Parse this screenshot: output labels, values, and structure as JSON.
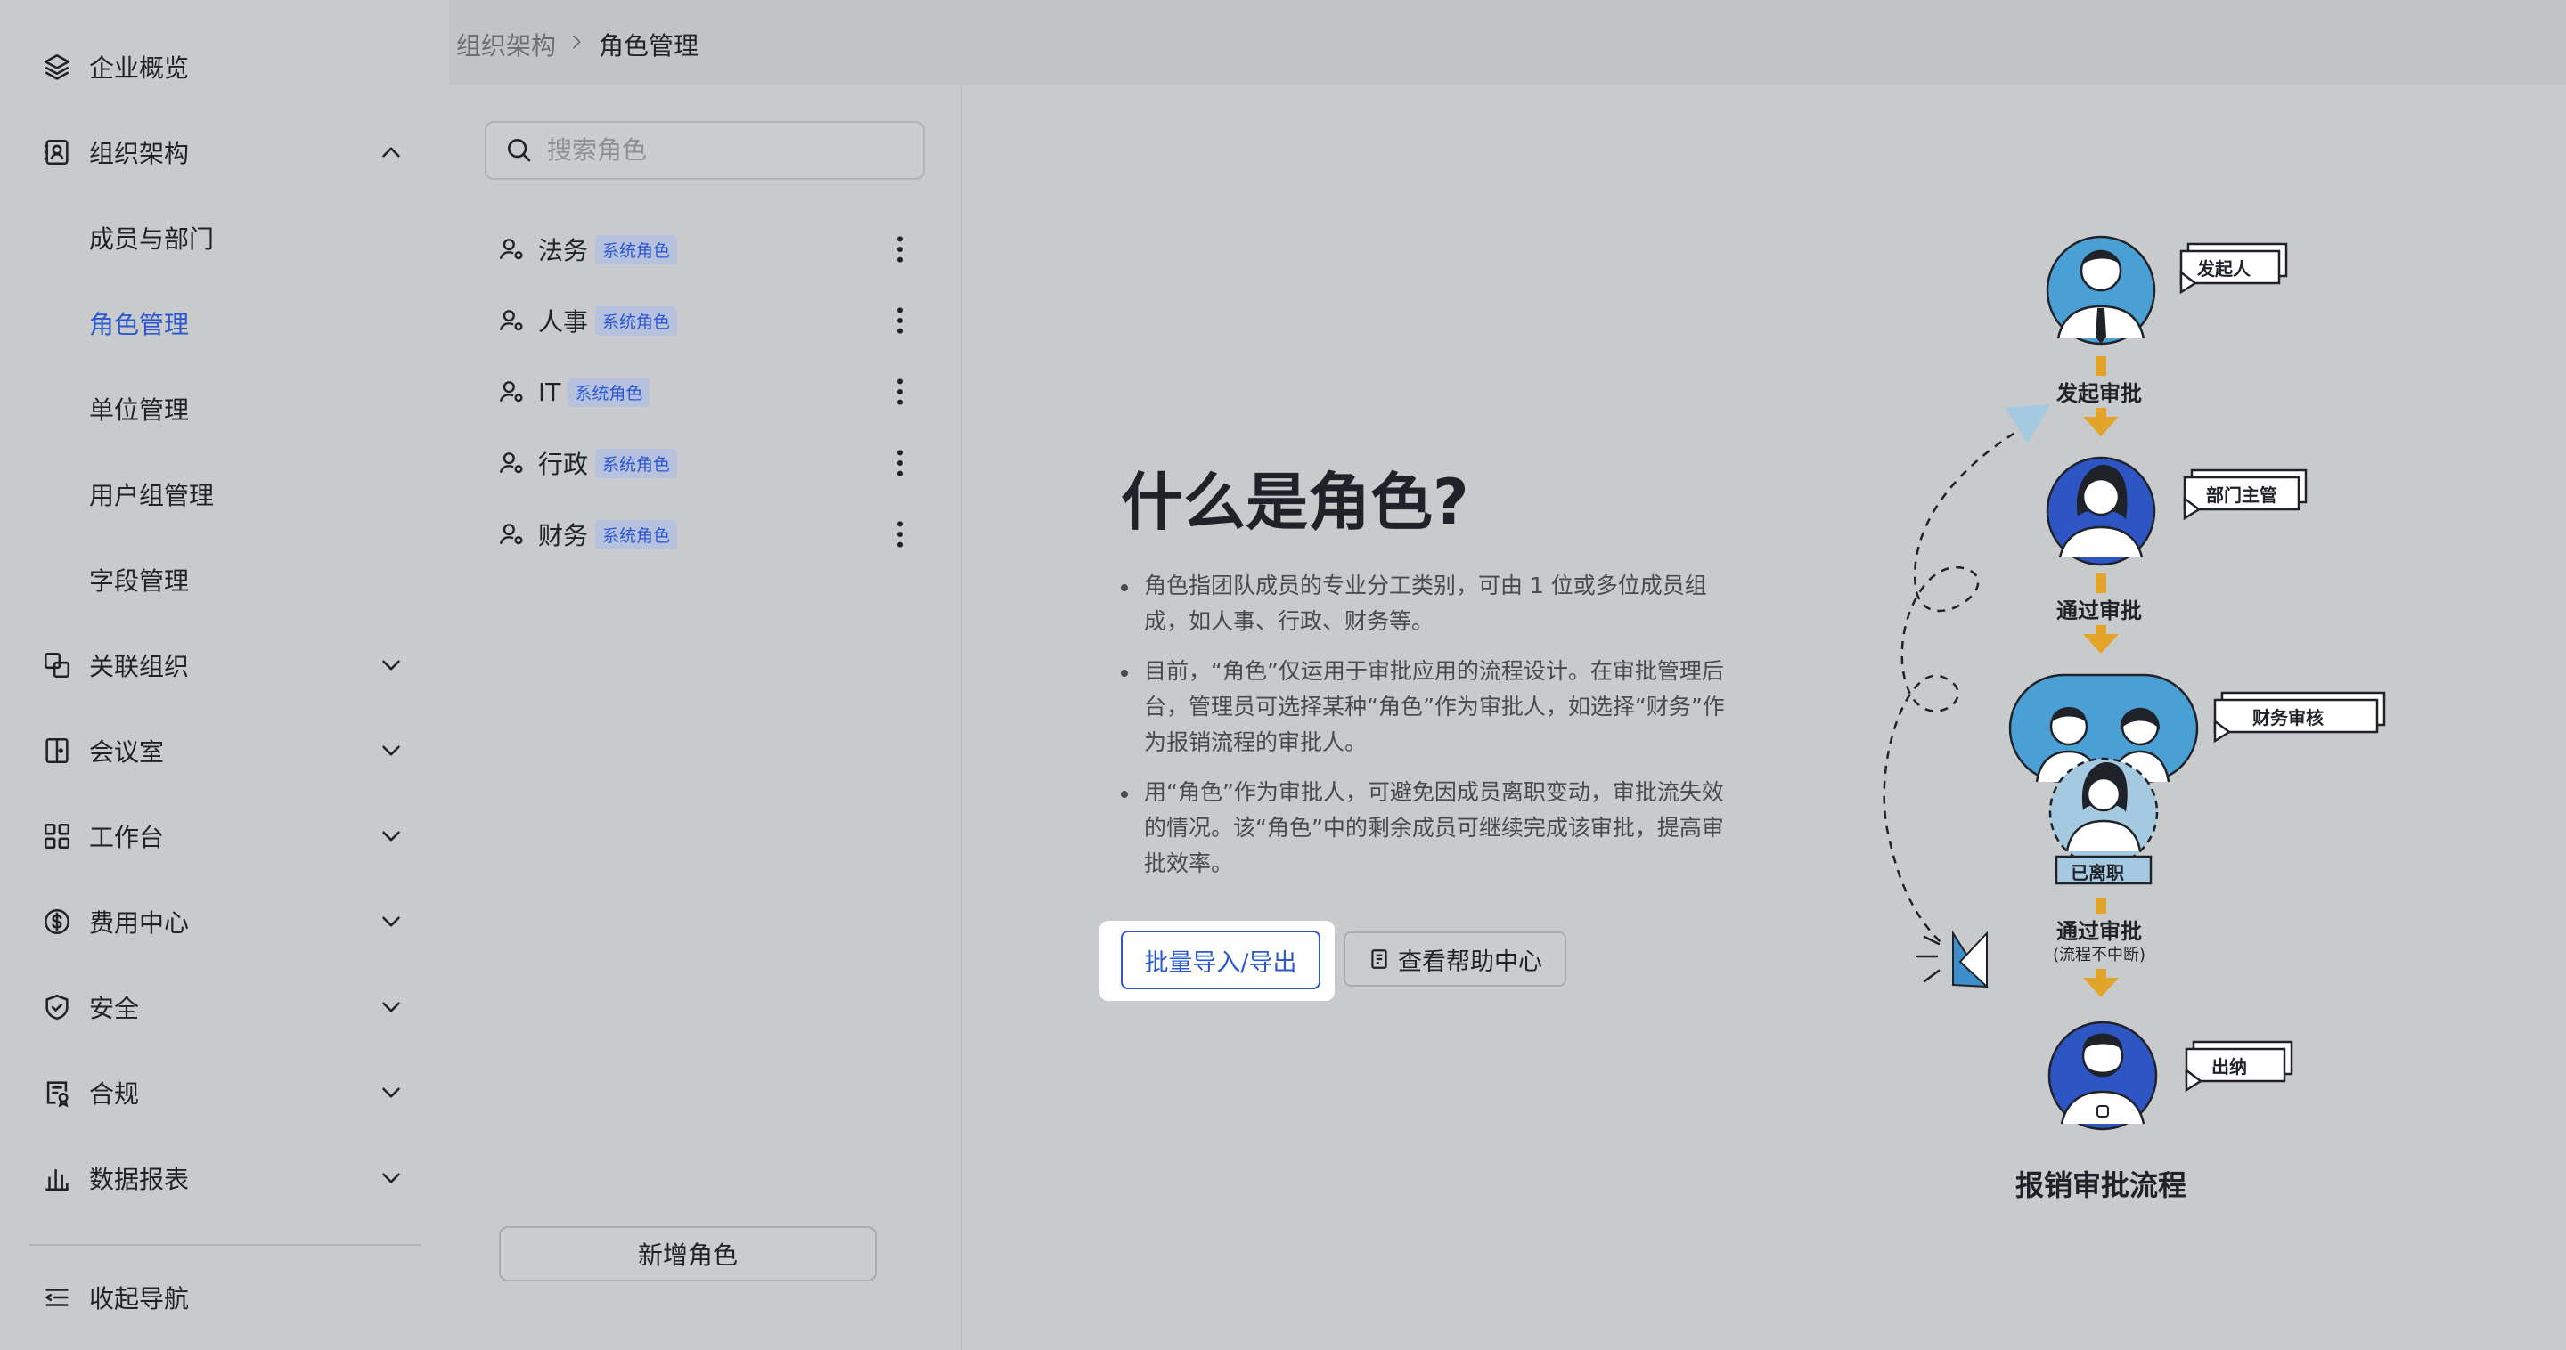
{
  "sidebar": {
    "items": [
      {
        "label": "企业概览",
        "icon": "layers-icon"
      },
      {
        "label": "组织架构",
        "icon": "contacts-icon"
      },
      {
        "label": "关联组织",
        "icon": "linked-org-icon"
      },
      {
        "label": "会议室",
        "icon": "meeting-room-icon"
      },
      {
        "label": "工作台",
        "icon": "grid-icon"
      },
      {
        "label": "费用中心",
        "icon": "dollar-icon"
      },
      {
        "label": "安全",
        "icon": "shield-icon"
      },
      {
        "label": "合规",
        "icon": "compliance-icon"
      },
      {
        "label": "数据报表",
        "icon": "bar-chart-icon"
      }
    ],
    "sub_items": [
      "成员与部门",
      "角色管理",
      "单位管理",
      "用户组管理",
      "字段管理"
    ],
    "active_sub": "角色管理",
    "collapse_label": "收起导航"
  },
  "breadcrumb": {
    "parent": "组织架构",
    "current": "角色管理"
  },
  "search": {
    "placeholder": "搜索角色"
  },
  "roles": [
    {
      "name": "法务",
      "badge": "系统角色"
    },
    {
      "name": "人事",
      "badge": "系统角色"
    },
    {
      "name": "IT",
      "badge": "系统角色"
    },
    {
      "name": "行政",
      "badge": "系统角色"
    },
    {
      "name": "财务",
      "badge": "系统角色"
    }
  ],
  "add_role_label": "新增角色",
  "main": {
    "title": "什么是角色?",
    "bullets": [
      "角色指团队成员的专业分工类别，可由 1 位或多位成员组成，如人事、行政、财务等。",
      "目前，“角色”仅运用于审批应用的流程设计。在审批管理后台，管理员可选择某种“角色”作为审批人，如选择“财务”作为报销流程的审批人。",
      "用“角色”作为审批人，可避免因成员离职变动，审批流失效的情况。该“角色”中的剩余成员可继续完成该审批，提高审批效率。"
    ],
    "import_export_label": "批量导入/导出",
    "help_label": "查看帮助中心"
  },
  "illustration": {
    "tags": {
      "initiator": "发起人",
      "dept_head": "部门主管",
      "finance_review": "财务审核",
      "left": "已离职",
      "cashier": "出纳"
    },
    "steps": {
      "initiate": "发起审批",
      "approve1": "通过审批",
      "approve2": "通过审批",
      "approve2_note": "(流程不中断)"
    },
    "title": "报销审批流程"
  },
  "colors": {
    "accent": "#2b57d1",
    "person_light_blue": "#4a9fd4",
    "person_dark_blue": "#2e55c4",
    "arrow_yellow": "#e2a52a"
  }
}
